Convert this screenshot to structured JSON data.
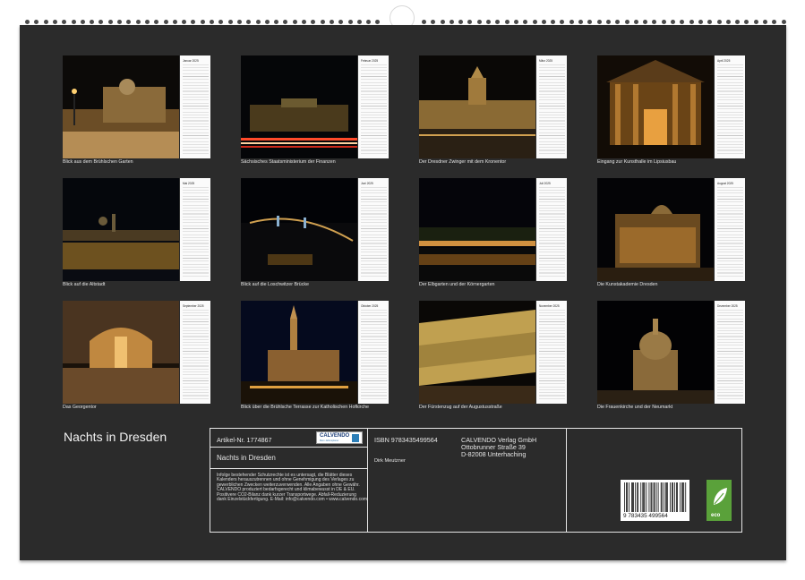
{
  "months": [
    {
      "name": "Januar 2025",
      "caption": "Blick aus dem Brühlschen Garten",
      "scene": "snow-palace"
    },
    {
      "name": "Februar 2025",
      "caption": "Sächsisches Staatsministerium der Finanzen",
      "scene": "light-trails"
    },
    {
      "name": "März 2025",
      "caption": "Der Dresdner Zwinger mit dem Kronentor",
      "scene": "zwinger"
    },
    {
      "name": "April 2025",
      "caption": "Eingang zur Kunsthalle im Lipsiusbau",
      "scene": "portal"
    },
    {
      "name": "Mai 2025",
      "caption": "Blick auf die Altstadt",
      "scene": "skyline"
    },
    {
      "name": "Juni 2025",
      "caption": "Blick auf die Loschwitzer Brücke",
      "scene": "bridge"
    },
    {
      "name": "Juli 2025",
      "caption": "Der Elbgarten und der Körnergarten",
      "scene": "riverbank"
    },
    {
      "name": "August 2025",
      "caption": "Die Kunstakademie Dresden",
      "scene": "academy"
    },
    {
      "name": "September 2025",
      "caption": "Das Georgentor",
      "scene": "arch"
    },
    {
      "name": "Oktober 2025",
      "caption": "Blick über die Brühlsche Terrasse zur Katholischen Hofkirche",
      "scene": "church"
    },
    {
      "name": "November 2025",
      "caption": "Der Fürstenzug auf der Augustusstraße",
      "scene": "mural"
    },
    {
      "name": "Dezember 2025",
      "caption": "Die Frauenkirche und der Neumarkt",
      "scene": "frauenkirche"
    }
  ],
  "title": "Nachts in Dresden",
  "info": {
    "article": "Artikel-Nr. 1774867",
    "title": "Nachts in Dresden",
    "legal": "Infolge bestehender Schutzrechte ist es untersagt, die Blätter dieses Kalenders herauszutrennen und ohne Genehmigung des Verlages zu gewerblichen Zwecken weiterzuverwenden. Alle Angaben ohne Gewähr. CALVENDO produziert bedarfsgerecht und klimabewusst in DE & EU. Positivere CO2-Bilanz dank kurzer Transportwege. Abfall-Reduzierung dank Einzelstückfertigung. E-Mail: info@calvendo.com • www.calvendo.com",
    "isbn": "ISBN 9783435499564",
    "author": "Dirk Meutzner",
    "publisher_line1": "CALVENDO Verlag GmbH",
    "publisher_line2": "Ottobrunner Straße 39",
    "publisher_line3": "D-82008 Unterhaching",
    "logo_text": "CALVENDO",
    "logo_sub": "Mein Jahresplaner",
    "barcode_digits": "9 783435 499564",
    "eco_label": "eco"
  }
}
